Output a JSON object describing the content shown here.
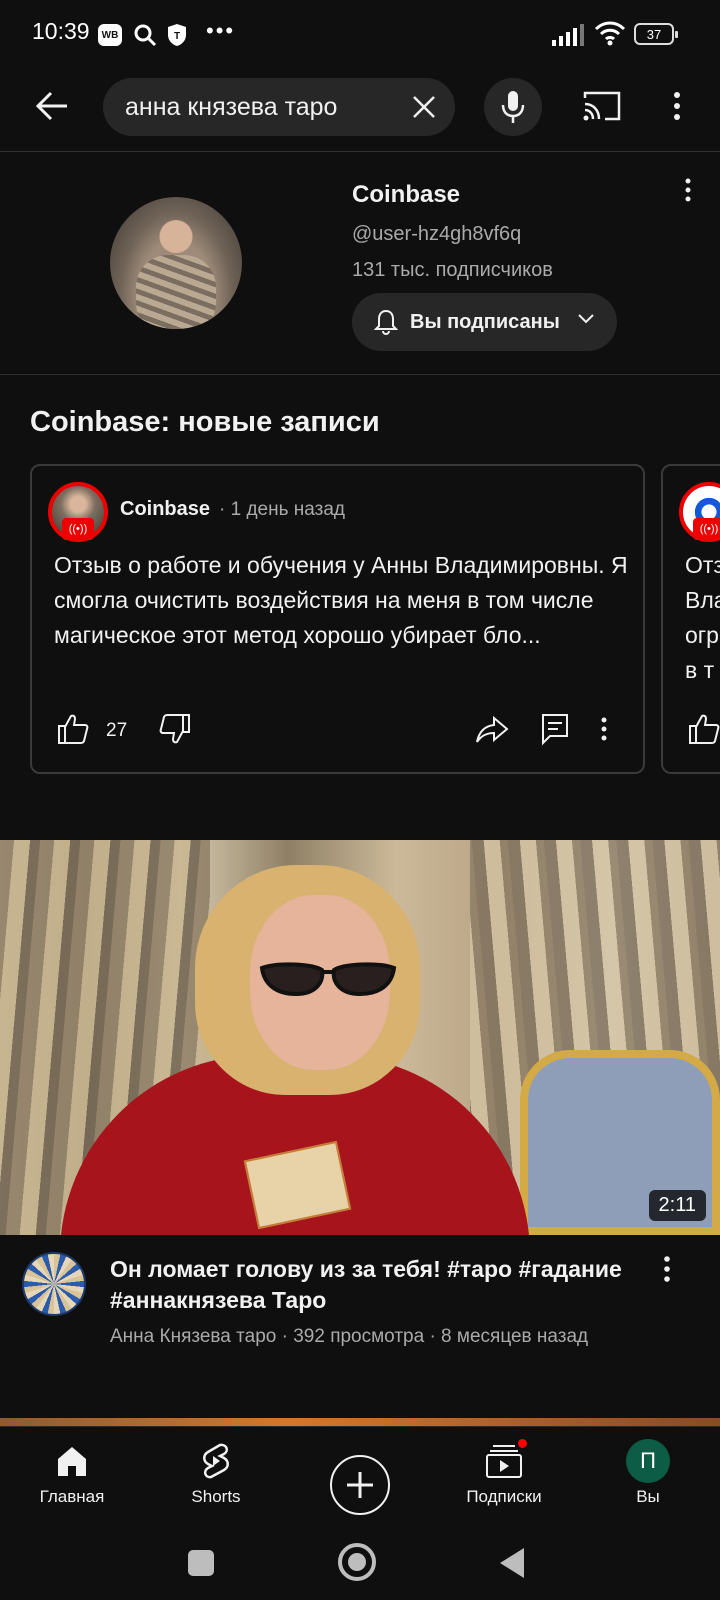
{
  "status_bar": {
    "time": "10:39",
    "app_badge": "WB",
    "battery": "37"
  },
  "search": {
    "query": "анна князева таро"
  },
  "channel": {
    "name": "Coinbase",
    "handle": "@user-hz4gh8vf6q",
    "subscribers": "131 тыс. подписчиков",
    "subscribe_button": "Вы подписаны"
  },
  "posts": {
    "section_title": "Coinbase: новые записи",
    "items": [
      {
        "author": "Coinbase",
        "time": "· 1 день назад",
        "text": "Отзыв о работе и обучения у Анны Владимировны. Я смогла очистить воздействия  на меня в том числе магическое этот метод хорошо убирает бло...",
        "likes": "27"
      },
      {
        "text_lines": [
          "Отз",
          "Вла",
          "огр",
          "в т"
        ]
      }
    ]
  },
  "video": {
    "duration": "2:11",
    "title": "Он ломает голову из за тебя! #таро #гадание #аннакнязева Таро",
    "subtitle": "Анна Князева таро · 392 просмотра · 8 месяцев назад"
  },
  "bottom_nav": {
    "home": "Главная",
    "shorts": "Shorts",
    "subscriptions": "Подписки",
    "you": "Вы",
    "you_avatar_letter": "П"
  },
  "colors": {
    "background": "#0f0f0f",
    "live_red": "#ff0000",
    "avatar_green": "#0d5c45"
  }
}
